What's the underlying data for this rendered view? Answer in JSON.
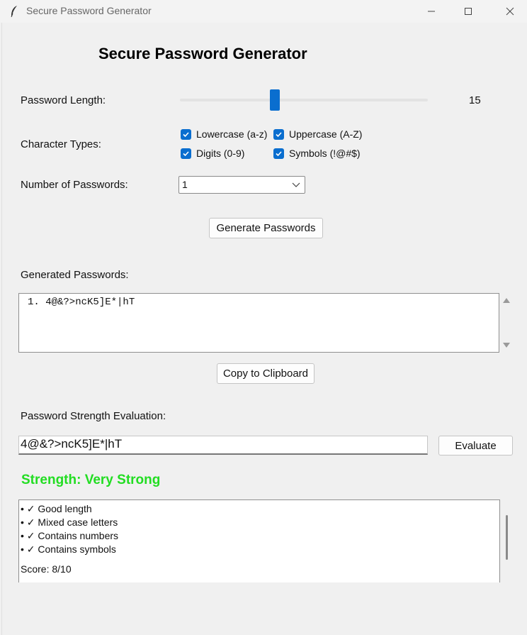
{
  "window": {
    "title": "Secure Password Generator",
    "icon": "feather-icon"
  },
  "heading": "Secure Password Generator",
  "length": {
    "label": "Password Length:",
    "value": "15",
    "slider_fraction": 0.38
  },
  "char_types": {
    "label": "Character Types:",
    "options": [
      {
        "label": "Lowercase (a-z)",
        "checked": true
      },
      {
        "label": "Uppercase (A-Z)",
        "checked": true
      },
      {
        "label": "Digits (0-9)",
        "checked": true
      },
      {
        "label": "Symbols (!@#$)",
        "checked": true
      }
    ]
  },
  "count": {
    "label": "Number of Passwords:",
    "value": "1"
  },
  "generate_label": "Generate Passwords",
  "generated": {
    "label": "Generated Passwords:",
    "lines": [
      "1. 4@&?>ncK5]E*|hT"
    ]
  },
  "copy_label": "Copy to Clipboard",
  "evaluation": {
    "label": "Password Strength Evaluation:",
    "input_value": "4@&?>ncK5]E*|hT",
    "button_label": "Evaluate",
    "strength_text": "Strength: Very Strong",
    "strength_color": "#22dd22",
    "checks": [
      "• ✓ Good length",
      "• ✓ Mixed case letters",
      "• ✓ Contains numbers",
      "• ✓ Contains symbols"
    ],
    "score": "Score: 8/10"
  },
  "colors": {
    "accent": "#0a6ecf"
  }
}
